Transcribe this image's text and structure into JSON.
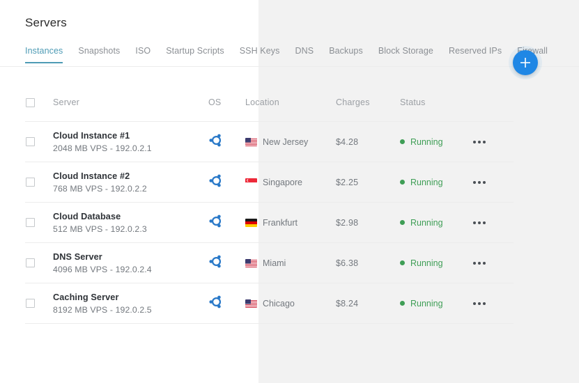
{
  "header": {
    "title": "Servers"
  },
  "tabs": [
    {
      "label": "Instances",
      "active": true
    },
    {
      "label": "Snapshots",
      "active": false
    },
    {
      "label": "ISO",
      "active": false
    },
    {
      "label": "Startup Scripts",
      "active": false
    },
    {
      "label": "SSH Keys",
      "active": false
    },
    {
      "label": "DNS",
      "active": false
    },
    {
      "label": "Backups",
      "active": false
    },
    {
      "label": "Block Storage",
      "active": false
    },
    {
      "label": "Reserved IPs",
      "active": false
    },
    {
      "label": "Firewall",
      "active": false
    }
  ],
  "add_button": {
    "icon": "plus-icon",
    "color": "#1f87e5"
  },
  "table": {
    "columns": [
      "Server",
      "OS",
      "Location",
      "Charges",
      "Status"
    ],
    "select_all": {
      "checked": false
    },
    "rows": [
      {
        "name": "Cloud Instance #1",
        "spec": "2048 MB VPS - 192.0.2.1",
        "os": "ubuntu-icon",
        "location": "New Jersey",
        "flag": "us-flag",
        "charges": "$4.28",
        "status": "Running",
        "status_color": "#3f9e56",
        "checked": false
      },
      {
        "name": "Cloud Instance #2",
        "spec": "768 MB VPS - 192.0.2.2",
        "os": "ubuntu-icon",
        "location": "Singapore",
        "flag": "sg-flag",
        "charges": "$2.25",
        "status": "Running",
        "status_color": "#3f9e56",
        "checked": false
      },
      {
        "name": "Cloud Database",
        "spec": "512 MB VPS - 192.0.2.3",
        "os": "ubuntu-icon",
        "location": "Frankfurt",
        "flag": "de-flag",
        "charges": "$2.98",
        "status": "Running",
        "status_color": "#3f9e56",
        "checked": false
      },
      {
        "name": "DNS Server",
        "spec": "4096 MB VPS - 192.0.2.4",
        "os": "ubuntu-icon",
        "location": "Miami",
        "flag": "us-flag",
        "charges": "$6.38",
        "status": "Running",
        "status_color": "#3f9e56",
        "checked": false
      },
      {
        "name": "Caching Server",
        "spec": "8192 MB VPS - 192.0.2.5",
        "os": "ubuntu-icon",
        "location": "Chicago",
        "flag": "us-flag",
        "charges": "$8.24",
        "status": "Running",
        "status_color": "#3f9e56",
        "checked": false
      }
    ],
    "row_menu_icon": "ellipsis-icon"
  },
  "theme": {
    "accent": "#4e9bb5",
    "fab": "#1f87e5",
    "overlay_bg": "#f2f2f2",
    "text_muted": "#73787e"
  }
}
